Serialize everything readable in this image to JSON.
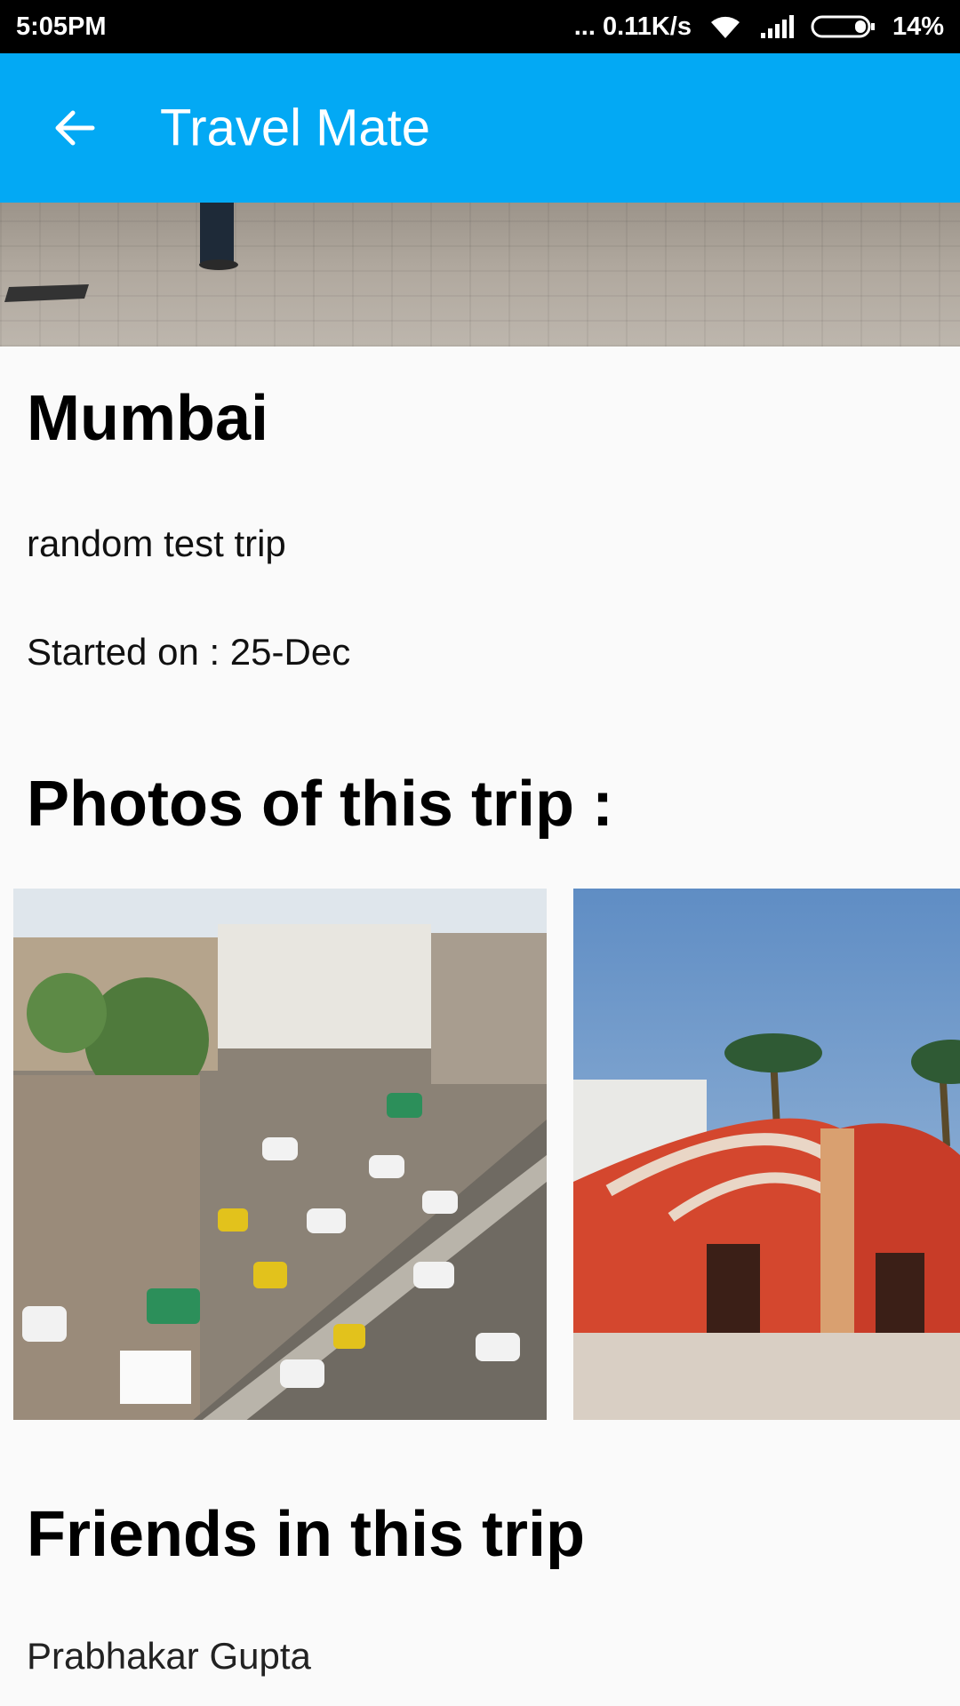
{
  "status_bar": {
    "time": "5:05PM",
    "network_speed": "... 0.11K/s",
    "battery": "14%",
    "icons": [
      "wifi-icon",
      "signal-icon",
      "battery-icon"
    ]
  },
  "app_bar": {
    "title": "Travel Mate",
    "back_icon": "arrow-back-icon",
    "color": "#03a9f4"
  },
  "trip": {
    "name": "Mumbai",
    "description": "random test trip",
    "started": "Started on : 25-Dec"
  },
  "photos": {
    "heading": "Photos of this trip :",
    "items": [
      "street-traffic-photo",
      "jantar-mantar-photo"
    ]
  },
  "friends": {
    "heading": "Friends in this trip",
    "items": [
      "Prabhakar Gupta"
    ]
  }
}
